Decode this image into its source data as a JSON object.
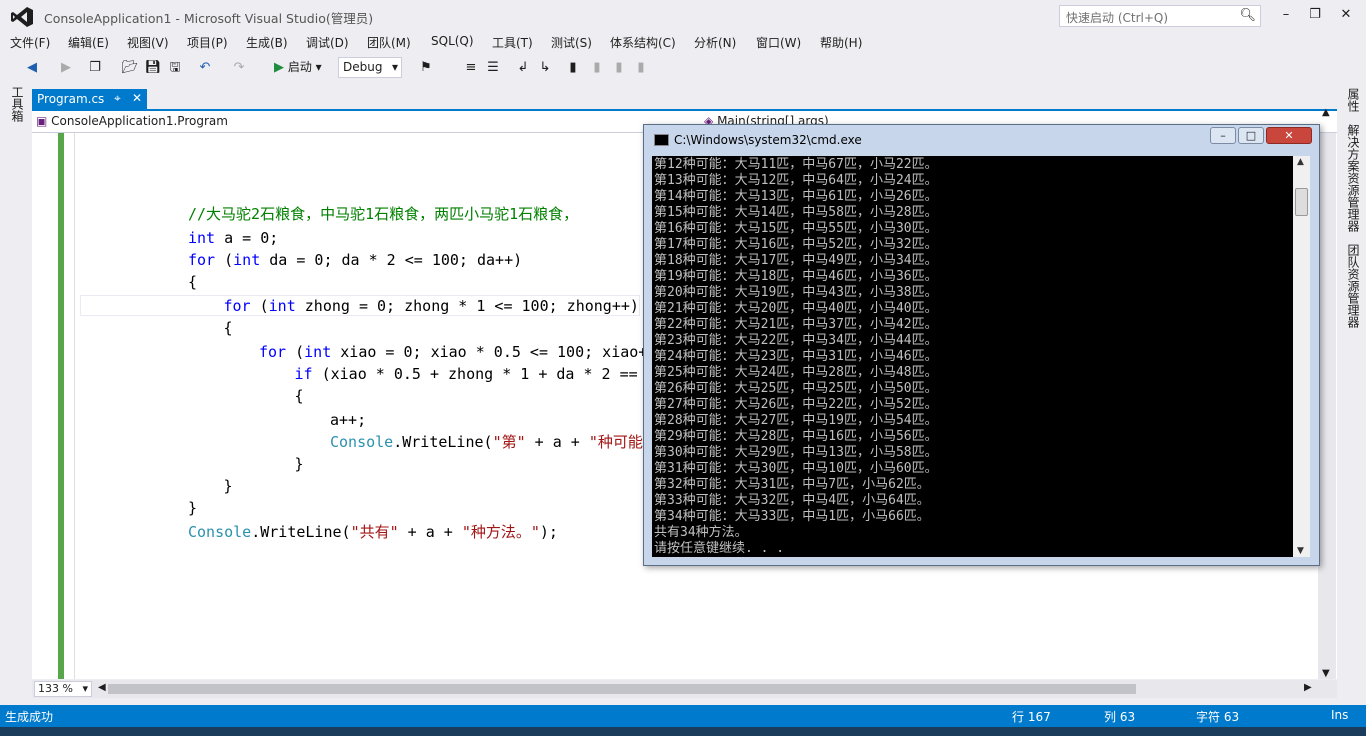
{
  "window": {
    "title": "ConsoleApplication1 - Microsoft Visual Studio(管理员)",
    "quick_launch_placeholder": "快速启动 (Ctrl+Q)"
  },
  "menu": [
    "文件(F)",
    "编辑(E)",
    "视图(V)",
    "项目(P)",
    "生成(B)",
    "调试(D)",
    "团队(M)",
    "SQL(Q)",
    "工具(T)",
    "测试(S)",
    "体系结构(C)",
    "分析(N)",
    "窗口(W)",
    "帮助(H)"
  ],
  "toolbar": {
    "start_label": "启动",
    "config_value": "Debug"
  },
  "left_strip_label": "工具箱",
  "right_tabs": [
    "属性",
    "解决方案资源管理器",
    "团队资源管理器"
  ],
  "doc_tab": {
    "label": "Program.cs"
  },
  "nav": {
    "class": "ConsoleApplication1.Program",
    "method": "Main(string[] args)"
  },
  "code_lines": [
    {
      "indent": 3,
      "tokens": [
        {
          "t": "cm",
          "v": "//大马驼2石粮食，中马驼1石粮食，两匹小马驼1石粮食，"
        }
      ]
    },
    {
      "indent": 3,
      "tokens": [
        {
          "t": "kw",
          "v": "int"
        },
        {
          "t": "",
          "v": " a = 0;"
        }
      ]
    },
    {
      "indent": 3,
      "tokens": [
        {
          "t": "kw",
          "v": "for"
        },
        {
          "t": "",
          "v": " ("
        },
        {
          "t": "kw",
          "v": "int"
        },
        {
          "t": "",
          "v": " da = 0; da * 2 <= 100; da++)"
        }
      ]
    },
    {
      "indent": 3,
      "tokens": [
        {
          "t": "",
          "v": "{"
        }
      ]
    },
    {
      "indent": 4,
      "tokens": [
        {
          "t": "kw",
          "v": "for"
        },
        {
          "t": "",
          "v": " ("
        },
        {
          "t": "kw",
          "v": "int"
        },
        {
          "t": "",
          "v": " zhong = 0; zhong * 1 <= 100; zhong++)"
        }
      ]
    },
    {
      "indent": 4,
      "tokens": [
        {
          "t": "",
          "v": "{"
        }
      ]
    },
    {
      "indent": 5,
      "tokens": [
        {
          "t": "kw",
          "v": "for"
        },
        {
          "t": "",
          "v": " ("
        },
        {
          "t": "kw",
          "v": "int"
        },
        {
          "t": "",
          "v": " xiao = 0; xiao * 0.5 <= 100; xiao+"
        }
      ]
    },
    {
      "indent": 6,
      "tokens": [
        {
          "t": "kw",
          "v": "if"
        },
        {
          "t": "",
          "v": " (xiao * 0.5 + zhong * 1 + da * 2 =="
        }
      ]
    },
    {
      "indent": 6,
      "tokens": [
        {
          "t": "",
          "v": "{"
        }
      ]
    },
    {
      "indent": 7,
      "tokens": [
        {
          "t": "",
          "v": "a++;"
        }
      ]
    },
    {
      "indent": 7,
      "tokens": [
        {
          "t": "ty",
          "v": "Console"
        },
        {
          "t": "",
          "v": ".WriteLine("
        },
        {
          "t": "st",
          "v": "\"第\""
        },
        {
          "t": "",
          "v": " + a + "
        },
        {
          "t": "st",
          "v": "\"种可能"
        }
      ]
    },
    {
      "indent": 6,
      "tokens": [
        {
          "t": "",
          "v": "}"
        }
      ]
    },
    {
      "indent": 4,
      "tokens": [
        {
          "t": "",
          "v": "}"
        }
      ]
    },
    {
      "indent": 3,
      "tokens": [
        {
          "t": "",
          "v": "}"
        }
      ]
    },
    {
      "indent": 3,
      "tokens": [
        {
          "t": "ty",
          "v": "Console"
        },
        {
          "t": "",
          "v": ".WriteLine("
        },
        {
          "t": "st",
          "v": "\"共有\""
        },
        {
          "t": "",
          "v": " + a + "
        },
        {
          "t": "st",
          "v": "\"种方法。\""
        },
        {
          "t": "",
          "v": ");"
        }
      ]
    }
  ],
  "zoom": "133 %",
  "cmd": {
    "title": "C:\\Windows\\system32\\cmd.exe",
    "lines": [
      "第12种可能：大马11匹，中马67匹，小马22匹。",
      "第13种可能：大马12匹，中马64匹，小马24匹。",
      "第14种可能：大马13匹，中马61匹，小马26匹。",
      "第15种可能：大马14匹，中马58匹，小马28匹。",
      "第16种可能：大马15匹，中马55匹，小马30匹。",
      "第17种可能：大马16匹，中马52匹，小马32匹。",
      "第18种可能：大马17匹，中马49匹，小马34匹。",
      "第19种可能：大马18匹，中马46匹，小马36匹。",
      "第20种可能：大马19匹，中马43匹，小马38匹。",
      "第21种可能：大马20匹，中马40匹，小马40匹。",
      "第22种可能：大马21匹，中马37匹，小马42匹。",
      "第23种可能：大马22匹，中马34匹，小马44匹。",
      "第24种可能：大马23匹，中马31匹，小马46匹。",
      "第25种可能：大马24匹，中马28匹，小马48匹。",
      "第26种可能：大马25匹，中马25匹，小马50匹。",
      "第27种可能：大马26匹，中马22匹，小马52匹。",
      "第28种可能：大马27匹，中马19匹，小马54匹。",
      "第29种可能：大马28匹，中马16匹，小马56匹。",
      "第30种可能：大马29匹，中马13匹，小马58匹。",
      "第31种可能：大马30匹，中马10匹，小马60匹。",
      "第32种可能：大马31匹，中马7匹，小马62匹。",
      "第33种可能：大马32匹，中马4匹，小马64匹。",
      "第34种可能：大马33匹，中马1匹，小马66匹。",
      "共有34种方法。",
      "请按任意键继续. . ."
    ]
  },
  "status": {
    "message": "生成成功",
    "line": "行 167",
    "col": "列 63",
    "char": "字符 63",
    "mode": "Ins"
  },
  "colors": {
    "accent": "#007ACC",
    "vs_purple": "#68217A"
  }
}
